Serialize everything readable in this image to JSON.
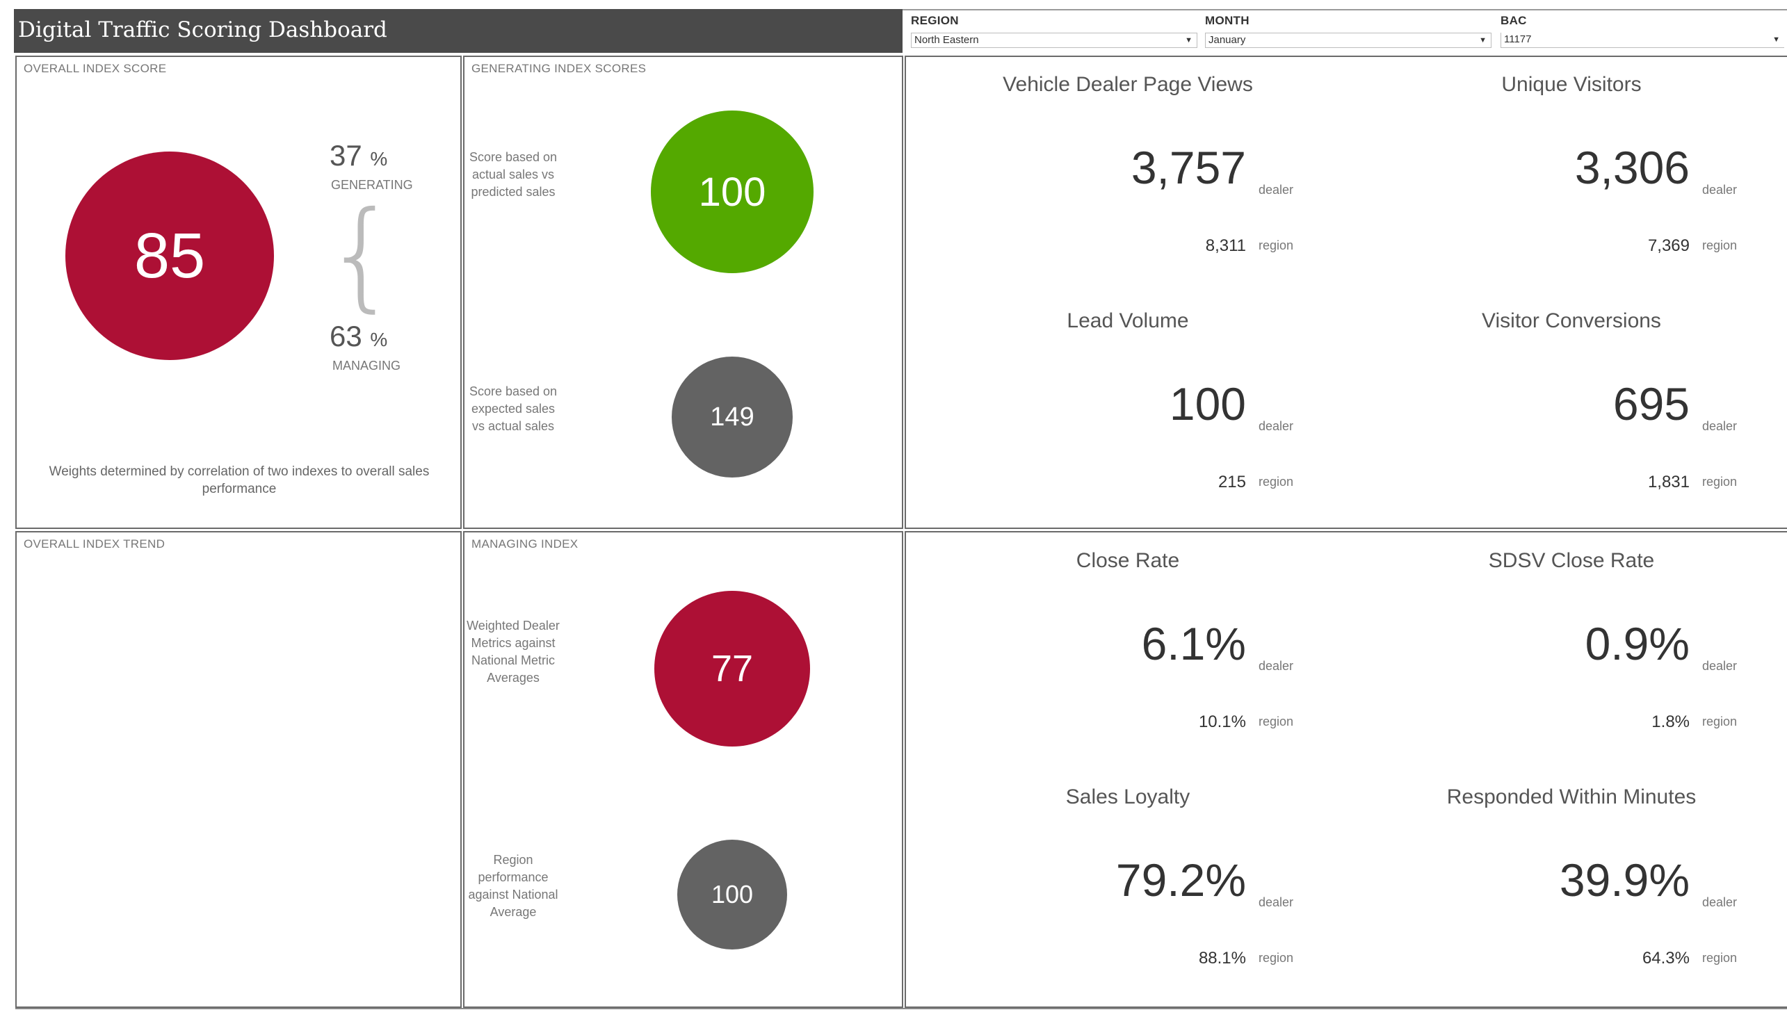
{
  "header": {
    "title": "Digital Traffic Scoring Dashboard"
  },
  "filters": {
    "region": {
      "label": "REGION",
      "value": "North Eastern"
    },
    "month": {
      "label": "MONTH",
      "value": "January"
    },
    "bac": {
      "label": "BAC",
      "value": "11177"
    }
  },
  "overall": {
    "title": "OVERALL INDEX SCORE",
    "score": "85",
    "score_color": "#ad1035",
    "generating_pct": "37",
    "generating_label": "GENERATING",
    "managing_pct": "63",
    "managing_label": "MANAGING",
    "pct_sign": "%",
    "brace": "{",
    "note": "Weights determined by correlation of two indexes to overall sales performance"
  },
  "generating": {
    "title": "GENERATING INDEX SCORES",
    "items": [
      {
        "caption": "Score based on actual sales vs predicted sales",
        "value": "100",
        "color": "#54a900"
      },
      {
        "caption": "Score based on expected sales vs actual sales",
        "value": "149",
        "color": "#636363"
      }
    ]
  },
  "trend": {
    "title": "OVERALL INDEX TREND"
  },
  "managing": {
    "title": "MANAGING INDEX",
    "items": [
      {
        "caption": "Weighted Dealer Metrics against National Metric Averages",
        "value": "77",
        "color": "#ad1035"
      },
      {
        "caption": "Region performance against National Average",
        "value": "100",
        "color": "#636363"
      }
    ]
  },
  "units": {
    "dealer": "dealer",
    "region": "region"
  },
  "metrics": [
    {
      "title": "Vehicle Dealer Page Views",
      "dealer": "3,757",
      "region": "8,311"
    },
    {
      "title": "Unique Visitors",
      "dealer": "3,306",
      "region": "7,369"
    },
    {
      "title": "Lead Volume",
      "dealer": "100",
      "region": "215"
    },
    {
      "title": "Visitor Conversions",
      "dealer": "695",
      "region": "1,831"
    },
    {
      "title": "Close Rate",
      "dealer": "6.1%",
      "region": "10.1%"
    },
    {
      "title": "SDSV Close Rate",
      "dealer": "0.9%",
      "region": "1.8%"
    },
    {
      "title": "Sales Loyalty",
      "dealer": "79.2%",
      "region": "88.1%"
    },
    {
      "title": "Responded Within Minutes",
      "dealer": "39.9%",
      "region": "64.3%"
    }
  ]
}
